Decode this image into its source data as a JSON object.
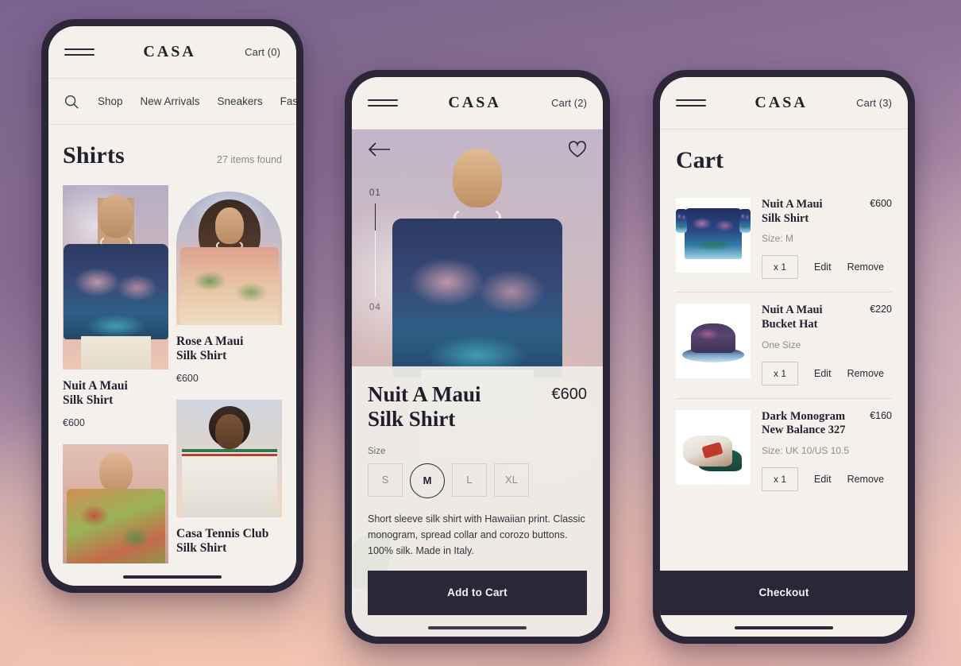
{
  "brand": "CASA",
  "browse": {
    "cart_label": "Cart (0)",
    "nav_items": [
      "Shop",
      "New Arrivals",
      "Sneakers",
      "Fas"
    ],
    "title": "Shirts",
    "items_found": "27 items found",
    "products": [
      {
        "name": "Nuit A Maui\nSilk Shirt",
        "price": "€600"
      },
      {
        "name": "Rose A Maui\nSilk Shirt",
        "price": "€600"
      },
      {
        "name": "Casa Tennis Club\nSilk Shirt",
        "price": ""
      }
    ]
  },
  "detail": {
    "cart_label": "Cart (2)",
    "pager_current": "01",
    "pager_total": "04",
    "title": "Nuit A Maui\nSilk Shirt",
    "price": "€600",
    "size_label": "Size",
    "sizes": [
      "S",
      "M",
      "L",
      "XL"
    ],
    "selected_size": "M",
    "description": "Short sleeve silk shirt with Hawaiian print. Classic monogram, spread collar and corozo buttons. 100% silk. Made in Italy.",
    "cta_label": "Add to Cart"
  },
  "cart": {
    "cart_label": "Cart (3)",
    "title": "Cart",
    "items": [
      {
        "name": "Nuit A Maui\nSilk Shirt",
        "price": "€600",
        "size": "Size: M",
        "qty": "x 1",
        "edit_label": "Edit",
        "remove_label": "Remove"
      },
      {
        "name": "Nuit A Maui\nBucket Hat",
        "price": "€220",
        "size": "One Size",
        "qty": "x 1",
        "edit_label": "Edit",
        "remove_label": "Remove"
      },
      {
        "name": "Dark Monogram\nNew Balance 327",
        "price": "€160",
        "size": "Size: UK 10/US 10.5",
        "qty": "x 1",
        "edit_label": "Edit",
        "remove_label": "Remove"
      }
    ],
    "checkout_label": "Checkout"
  },
  "colors": {
    "ink": "#2b2738",
    "screen_bg": "#f4f1ec",
    "muted": "#8b8691"
  }
}
